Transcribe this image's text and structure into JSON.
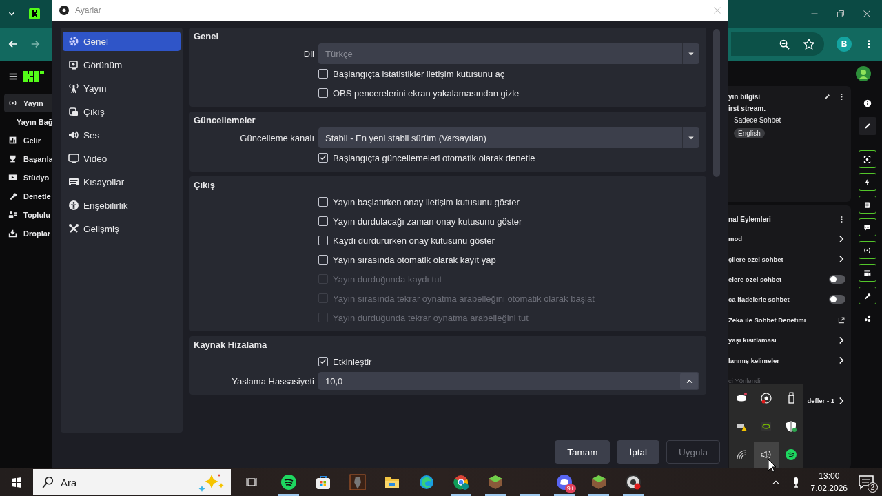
{
  "browser": {
    "profile_initial": "B",
    "sidebar": [
      {
        "label": "Yayın",
        "selected": true,
        "children": [
          {
            "label": "Yayın Bağ",
            "selected": false
          }
        ]
      },
      {
        "label": "Gelir",
        "selected": false
      },
      {
        "label": "Başarıla",
        "selected": false
      },
      {
        "label": "Stüdyo",
        "selected": false
      },
      {
        "label": "Denetle",
        "selected": false
      },
      {
        "label": "Toplulu",
        "selected": false
      },
      {
        "label": "Droplar",
        "selected": false
      }
    ],
    "info_card": {
      "title": "yın bilgisi",
      "stream_title": "irst stream.",
      "chat_mode": "Sadece Sohbet",
      "tag": "English"
    },
    "actions_card": {
      "title": "nal Eylemleri",
      "rows": [
        {
          "kind": "chevron",
          "label": "mod"
        },
        {
          "kind": "chevron",
          "label": "çilere özel sohbet"
        },
        {
          "kind": "toggle",
          "label": "elere özel sohbet",
          "on": false
        },
        {
          "kind": "toggle",
          "label": "ca ifadelerle sohbet",
          "on": false
        },
        {
          "kind": "external",
          "label": "Zeka ile Sohbet Denetimi"
        },
        {
          "kind": "chevron",
          "label": "yaşı kısıtlaması"
        },
        {
          "kind": "chevron",
          "label": "lanmış kelimeler"
        },
        {
          "kind": "muted",
          "label": "ci Yönlendir"
        },
        {
          "kind": "chevron",
          "label": "defler - 1"
        }
      ]
    }
  },
  "dialog": {
    "title": "Ayarlar",
    "nav": [
      {
        "label": "Genel",
        "selected": true
      },
      {
        "label": "Görünüm",
        "selected": false
      },
      {
        "label": "Yayın",
        "selected": false
      },
      {
        "label": "Çıkış",
        "selected": false
      },
      {
        "label": "Ses",
        "selected": false
      },
      {
        "label": "Video",
        "selected": false
      },
      {
        "label": "Kısayollar",
        "selected": false
      },
      {
        "label": "Erişebilirlik",
        "selected": false
      },
      {
        "label": "Gelişmiş",
        "selected": false
      }
    ],
    "sections": [
      {
        "title": "Genel",
        "rows": [
          {
            "kind": "select",
            "label": "Dil",
            "value": "Türkçe",
            "disabled": true
          },
          {
            "kind": "checkbox",
            "label": "Başlangıçta istatistikler iletişim kutusunu aç",
            "checked": false,
            "disabled": false
          },
          {
            "kind": "checkbox",
            "label": "OBS pencerelerini ekran yakalamasından gizle",
            "checked": false,
            "disabled": false
          }
        ]
      },
      {
        "title": "Güncellemeler",
        "rows": [
          {
            "kind": "select",
            "label": "Güncelleme kanalı",
            "value": "Stabil - En yeni stabil sürüm (Varsayılan)",
            "disabled": false
          },
          {
            "kind": "checkbox",
            "label": "Başlangıçta güncellemeleri otomatik olarak denetle",
            "checked": true,
            "disabled": false
          }
        ]
      },
      {
        "title": "Çıkış",
        "rows": [
          {
            "kind": "checkbox",
            "label": "Yayın başlatırken onay iletişim kutusunu göster",
            "checked": false,
            "disabled": false
          },
          {
            "kind": "checkbox",
            "label": "Yayın durdulacağı zaman onay kutusunu göster",
            "checked": false,
            "disabled": false
          },
          {
            "kind": "checkbox",
            "label": "Kaydı durdururken onay kutusunu göster",
            "checked": false,
            "disabled": false
          },
          {
            "kind": "checkbox",
            "label": "Yayın sırasında otomatik olarak kayıt yap",
            "checked": false,
            "disabled": false
          },
          {
            "kind": "checkbox",
            "label": "Yayın durduğunda kaydı tut",
            "checked": false,
            "disabled": true
          },
          {
            "kind": "checkbox",
            "label": "Yayın sırasında tekrar oynatma arabelleğini otomatik olarak başlat",
            "checked": false,
            "disabled": true
          },
          {
            "kind": "checkbox",
            "label": "Yayın durduğunda tekrar oynatma arabelleğini tut",
            "checked": false,
            "disabled": true
          }
        ]
      },
      {
        "title": "Kaynak Hizalama",
        "rows": [
          {
            "kind": "checkbox",
            "label": "Etkinleştir",
            "checked": true,
            "disabled": false
          },
          {
            "kind": "spin",
            "label": "Yaslama Hassasiyeti",
            "value": "10,0"
          }
        ]
      }
    ],
    "buttons": [
      {
        "label": "Tamam",
        "disabled": false
      },
      {
        "label": "İptal",
        "disabled": false
      },
      {
        "label": "Uygula",
        "disabled": true
      }
    ]
  },
  "taskbar": {
    "search": {
      "placeholder": "Ara"
    },
    "apps": [
      {
        "running": true
      },
      {
        "running": false
      },
      {
        "running": false
      },
      {
        "running": false
      },
      {
        "running": false
      },
      {
        "running": true
      },
      {
        "running": true
      },
      {
        "running": true
      },
      {
        "running": true,
        "badge": "9+"
      },
      {
        "running": true
      },
      {
        "running": true
      }
    ],
    "time": "13:00",
    "date": "7.02.2026",
    "notifications": "2"
  }
}
